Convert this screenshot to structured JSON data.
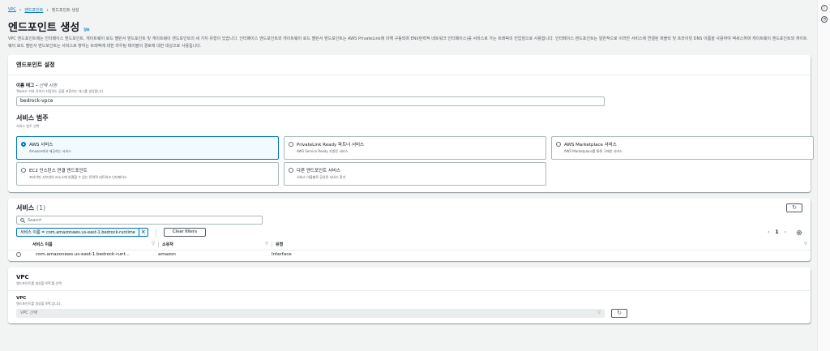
{
  "breadcrumb": {
    "root": "VPC",
    "parent": "엔드포인트",
    "current": "엔드포인트 생성"
  },
  "page": {
    "title": "엔드포인트 생성",
    "info": "정보",
    "description": "VPC 엔드포인트에는 인터페이스 엔드포인트, 게이트웨이 로드 밸런서 엔드포인트 및 게이트웨이 엔드포인트의 세 가지 유형이 있습니다. 인터페이스 엔드포인트와 게이트웨이 로드 밸런서 엔드포인트는 AWS PrivateLink에 의해 구동되며 ENI(탄력적 네트워크 인터페이스)를 서비스로 가는 트래픽의 진입점으로 사용합니다. 인터페이스 엔드포인트는 일반적으로 이러한 서비스에 연결된 퍼블릭 및 프라이빗 DNS 이름을 사용하여 액세스하며 게이트웨이 엔드포인트와 게이트웨이 로드 밸런서 엔드포인트는 서비스로 향하는 트래픽에 대한 라우팅 테이블의 경로에 대한 대상으로 사용됩니다."
  },
  "settings": {
    "header": "엔드포인트 설정",
    "name_tag_label": "이름 태그 - ",
    "name_tag_optional": "선택 사항",
    "name_tag_hint": "'Name' 키와 귀하가 지정하는 값을 포함하는 태그를 생성합니다.",
    "name_tag_value": "bedrock-vpce",
    "category_title": "서비스 범주",
    "category_hint": "서비스 범주 선택",
    "tiles": [
      {
        "title": "AWS 서비스",
        "desc": "Amazon에서 제공하는 서비스",
        "selected": true
      },
      {
        "title": "PrivateLink Ready 파트너 서비스",
        "desc": "AWS Service Ready 지원된 서비스",
        "selected": false
      },
      {
        "title": "AWS Marketplace 서비스",
        "desc": "AWS Marketplace를 통해 구매한 서비스",
        "selected": false
      },
      {
        "title": "EC2 인스턴스 연결 엔드포인트",
        "desc": "프라이빗 서브넷의 리소스에 연결할 수 있는 탄력적 네트워크 인터페이스",
        "selected": false
      },
      {
        "title": "다른 엔드포인트 서비스",
        "desc": "서비스 이름별로 공유된 서비스 찾기",
        "selected": false
      }
    ]
  },
  "services": {
    "title": "서비스",
    "count": "(1)",
    "refresh_icon": "refresh-icon",
    "search_placeholder": "Search",
    "filter_token": "서비스 이름 = com.amazonaws.us-east-1.bedrock-runtime",
    "clear_filters": "Clear filters",
    "page": "1",
    "columns": [
      "서비스 이름",
      "소유자",
      "유형"
    ],
    "rows": [
      {
        "name": "com.amazonaws.us-east-1.bedrock-runt...",
        "owner": "amazon",
        "type": "Interface"
      }
    ]
  },
  "vpc": {
    "header": "VPC",
    "header_hint": "엔드포인트를 생성할 VPC를 선택",
    "label": "VPC",
    "hint": "엔드포인트를 생성할 VPC입니다.",
    "placeholder": "VPC 선택"
  }
}
